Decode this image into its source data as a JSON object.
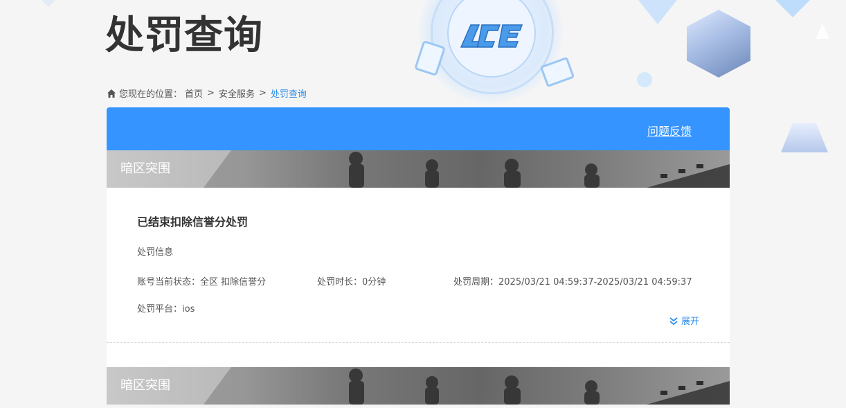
{
  "page": {
    "title": "处罚查询"
  },
  "breadcrumb": {
    "prefix": "您现在的位置：",
    "home": "首页",
    "section": "安全服务",
    "current": "处罚查询",
    "separator": ">"
  },
  "header_bar": {
    "feedback_label": "问题反馈"
  },
  "records": [
    {
      "game": "暗区突围",
      "title": "已结束扣除信誉分处罚",
      "subtitle": "处罚信息",
      "status_label": "账号当前状态：",
      "status_value": "全区 扣除信誉分",
      "duration_label": "处罚时长：",
      "duration_value": "0分钟",
      "period_label": "处罚周期：",
      "period_value": "2025/03/21 04:59:37-2025/03/21 04:59:37",
      "platform_label": "处罚平台：",
      "platform_value": "ios",
      "expand_label": "展开"
    },
    {
      "game": "暗区突围"
    }
  ],
  "colors": {
    "accent": "#3594ff",
    "link": "#2f8ee8",
    "title": "#333333"
  },
  "icons": {
    "home": "home-icon",
    "expand": "chevron-double-down-icon"
  }
}
